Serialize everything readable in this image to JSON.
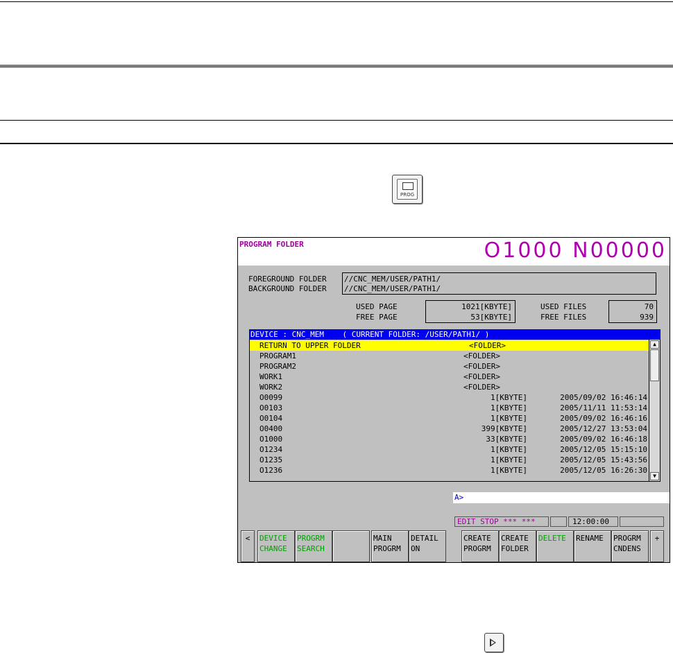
{
  "prog_key": {
    "label": "PROG",
    "icon": "prog-key-icon"
  },
  "screen": {
    "title": "PROGRAM FOLDER",
    "program_number": "O1000 N00000",
    "foreground_label": "FOREGROUND FOLDER",
    "foreground_path": "//CNC_MEM/USER/PATH1/",
    "background_label": "BACKGROUND FOLDER",
    "background_path": "//CNC_MEM/USER/PATH1/",
    "used_page_label": "USED PAGE",
    "used_page_value": "1021[KBYTE]",
    "free_page_label": "FREE PAGE",
    "free_page_value": "53[KBYTE]",
    "used_files_label": "USED FILES",
    "used_files_value": "70",
    "free_files_label": "FREE FILES",
    "free_files_value": "939",
    "list_header": "DEVICE : CNC_MEM    ( CURRENT FOLDER: /USER/PATH1/ )",
    "rows": [
      {
        "name": "RETURN TO UPPER FOLDER",
        "size": "<FOLDER>",
        "date": "",
        "selected": true
      },
      {
        "name": "PROGRAM1",
        "size": "<FOLDER>",
        "date": ""
      },
      {
        "name": "PROGRAM2",
        "size": "<FOLDER>",
        "date": ""
      },
      {
        "name": "WORK1",
        "size": "<FOLDER>",
        "date": ""
      },
      {
        "name": "WORK2",
        "size": "<FOLDER>",
        "date": ""
      },
      {
        "name": "O0099",
        "size": "1[KBYTE]",
        "date": "2005/09/02 16:46:14"
      },
      {
        "name": "O0103",
        "size": "1[KBYTE]",
        "date": "2005/11/11 11:53:14"
      },
      {
        "name": "O0104",
        "size": "1[KBYTE]",
        "date": "2005/09/02 16:46:16"
      },
      {
        "name": "O0400",
        "size": "399[KBYTE]",
        "date": "2005/12/27 13:53:04"
      },
      {
        "name": "O1000",
        "size": "33[KBYTE]",
        "date": "2005/09/02 16:46:18"
      },
      {
        "name": "O1234",
        "size": "1[KBYTE]",
        "date": "2005/12/05 15:15:10"
      },
      {
        "name": "O1235",
        "size": "1[KBYTE]",
        "date": "2005/12/05 15:43:56"
      },
      {
        "name": "O1236",
        "size": "1[KBYTE]",
        "date": "2005/12/05 16:26:30"
      }
    ],
    "input_prompt": "A>",
    "status_mode": "EDIT STOP *** ***",
    "clock": "12:00:00",
    "softkeys": {
      "prev": "<",
      "device_change": "DEVICE\nCHANGE",
      "progrm_search": "PROGRM\nSEARCH",
      "blank": "",
      "main_progrm": "MAIN\nPROGRM",
      "detail_on": "DETAIL\nON",
      "create_progrm": "CREATE\nPROGRM",
      "create_folder": "CREATE\nFOLDER",
      "delete": "DELETE",
      "rename": "RENAME",
      "progrm_cndens": "PROGRM\nCNDENS",
      "next": "+"
    }
  },
  "colors": {
    "title": "#a000a0",
    "header_bg": "#0000f0",
    "selected_row": "#ffff00",
    "softkey_green": "#00a000"
  }
}
